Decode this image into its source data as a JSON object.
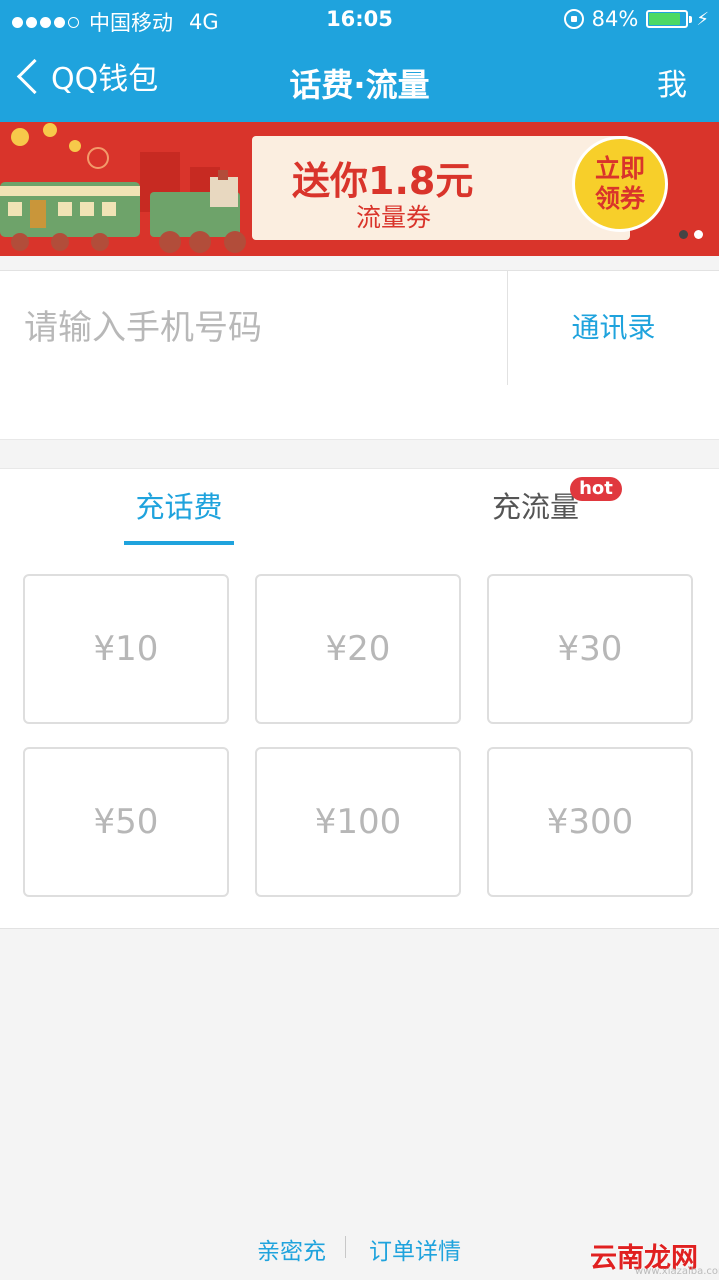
{
  "status_bar": {
    "carrier": "中国移动",
    "network": "4G",
    "time": "16:05",
    "battery": "84%",
    "battery_level": 0.84,
    "signal_bars": 4
  },
  "nav": {
    "back_label": "QQ钱包",
    "title": "话费·流量",
    "right_label": "我"
  },
  "banner": {
    "headline": "送你1.8元",
    "subline": "流量券",
    "cta": [
      "立即",
      "领券"
    ],
    "slides": 2,
    "active_slide": 1
  },
  "phone": {
    "placeholder": "请输入手机号码",
    "value": "",
    "contacts_label": "通讯录"
  },
  "tabs": [
    {
      "label": "充话费",
      "active": true
    },
    {
      "label": "充流量",
      "active": false,
      "badge": "hot"
    }
  ],
  "amounts": [
    "¥10",
    "¥20",
    "¥30",
    "¥50",
    "¥100",
    "¥300"
  ],
  "footer": {
    "link1": "亲密充",
    "link2": "订单详情"
  },
  "watermark": {
    "text": "云南龙网",
    "small": "www.xiazaiba.com"
  },
  "colors": {
    "accent": "#1fa3dd",
    "banner_red": "#d9342b",
    "badge_red": "#e0383e"
  }
}
